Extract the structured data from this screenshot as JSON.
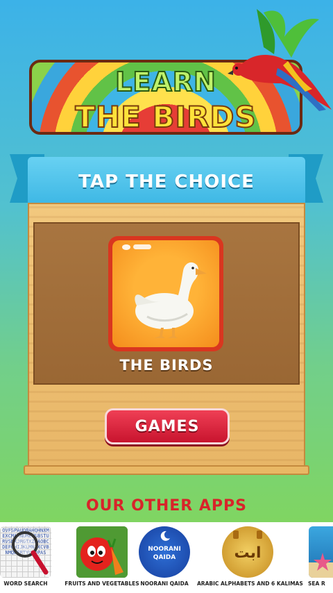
{
  "title": {
    "line1": "LEARN",
    "line2": "THE BIRDS"
  },
  "ribbon": {
    "label": "TAP THE CHOICE"
  },
  "choice": {
    "label": "THE BIRDS"
  },
  "games_button": {
    "label": "GAMES"
  },
  "other_apps": {
    "title": "OUR OTHER APPS",
    "apps": [
      {
        "label": "WORD SEARCH",
        "letters": "OVFSPAUOBAHQHNXMEXCMARNUMEWSBSTURVSNXJRGTXZWAOBCDEFGHIJKLMNZXCVBNMQWERTYUIOPAS"
      },
      {
        "label": "FRUITS AND VEGETABLES"
      },
      {
        "label": "NOORANI QAIDA",
        "icon_text_1": "NOORANI",
        "icon_text_2": "QAIDA"
      },
      {
        "label": "ARABIC ALPHABETS AND 6 KALIMAS",
        "icon_text": "ابت"
      },
      {
        "label": "SEA R"
      }
    ]
  },
  "colors": {
    "accent_red": "#d8242a",
    "ribbon_blue": "#3bb6e4",
    "wood": "#e8b667"
  }
}
